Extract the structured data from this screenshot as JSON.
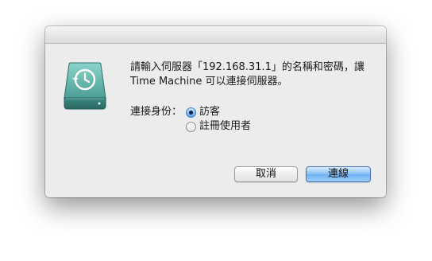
{
  "dialog": {
    "message_line1": "請輸入伺服器「192.168.31.1」的名稱和密碼，讓",
    "message_line2": "Time Machine 可以連接伺服器。",
    "identity_label": "連接身份：",
    "options": [
      {
        "label": "訪客",
        "selected": true
      },
      {
        "label": "註冊使用者",
        "selected": false
      }
    ],
    "cancel_label": "取消",
    "connect_label": "連線"
  },
  "icon": {
    "name": "time-machine-drive-icon"
  },
  "colors": {
    "drive_top": "#7fc9c0",
    "drive_body": "#4a9b92",
    "drive_base": "#2f6f69",
    "default_button": "#7fbaf3"
  }
}
